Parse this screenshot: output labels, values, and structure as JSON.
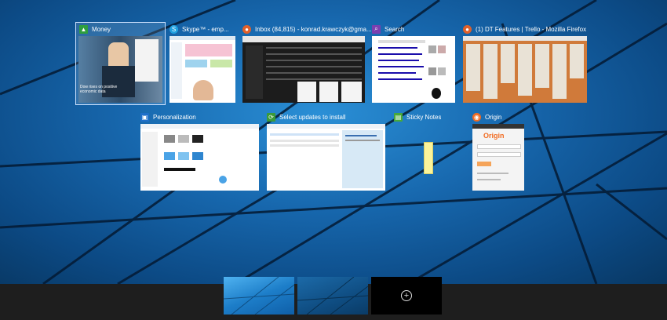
{
  "windows": [
    {
      "title": "Money",
      "icon": "money-icon",
      "icon_color": "#2e9e3e",
      "selected": true
    },
    {
      "title": "Skype™ - emp...",
      "icon": "skype-icon",
      "icon_color": "#1ea0e0"
    },
    {
      "title": "Inbox (84,815) - konrad.krawczyk@gma...",
      "icon": "firefox-icon",
      "icon_color": "#e0602a"
    },
    {
      "title": "Search",
      "icon": "search-icon",
      "icon_color": "#7a3fb0"
    },
    {
      "title": "(1) DT Features | Trello - Mozilla Firefox",
      "icon": "firefox-icon",
      "icon_color": "#e0602a"
    },
    {
      "title": "Personalization",
      "icon": "personalization-icon",
      "icon_color": "#1e6fc9"
    },
    {
      "title": "Select updates to install",
      "icon": "windows-update-icon",
      "icon_color": "#3a9a3a"
    },
    {
      "title": "Sticky Notes",
      "icon": "sticky-notes-icon",
      "icon_color": "#47a83a"
    },
    {
      "title": "Origin",
      "icon": "origin-icon",
      "icon_color": "#f26c22"
    }
  ],
  "money_thumb_text": "Dow rises on positive economic data",
  "origin_thumb_text": "Origin",
  "virtual_desktops": {
    "new_desktop_symbol": "+"
  },
  "colors": {
    "accent": "#1767ad",
    "taskbar": "#1e1e1e",
    "selection": "#cfe3ff"
  }
}
